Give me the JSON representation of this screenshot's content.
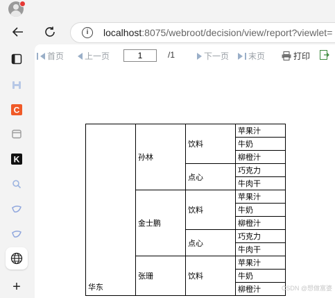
{
  "browser": {
    "url_host": "localhost",
    "url_rest": ":8075/webroot/decision/view/report?viewlet=",
    "sidebar_icons": [
      "tabs-icon",
      "extension-icon",
      "c-app-icon",
      "calendar-icon",
      "k-app-icon",
      "search-icon",
      "bird-icon",
      "bird-icon-2",
      "globe-icon",
      "add-icon"
    ]
  },
  "toolbar": {
    "first_page": "首页",
    "prev_page": "上一页",
    "page_number": "1",
    "total_pages": "/1",
    "next_page": "下一页",
    "last_page": "末页",
    "print": "打印"
  },
  "report": {
    "region": "华东",
    "people": [
      {
        "name": "孙林",
        "groups": [
          {
            "category": "饮料",
            "items": [
              "苹果汁",
              "牛奶",
              "柳橙汁"
            ]
          },
          {
            "category": "点心",
            "items": [
              "巧克力",
              "牛肉干"
            ]
          }
        ]
      },
      {
        "name": "金士鹏",
        "groups": [
          {
            "category": "饮料",
            "items": [
              "苹果汁",
              "牛奶",
              "柳橙汁"
            ]
          },
          {
            "category": "点心",
            "items": [
              "巧克力",
              "牛肉干"
            ]
          }
        ]
      },
      {
        "name": "张珊",
        "groups": [
          {
            "category": "饮料",
            "items": [
              "苹果汁",
              "牛奶",
              "柳橙汁"
            ]
          }
        ]
      }
    ]
  },
  "watermark": "CSDN @想做富婆"
}
